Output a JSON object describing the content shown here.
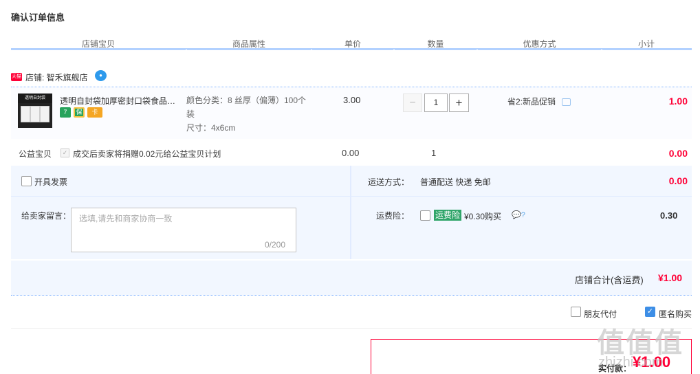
{
  "page": {
    "title": "确认订单信息"
  },
  "columns": [
    "店铺宝贝",
    "商品属性",
    "单价",
    "数量",
    "优惠方式",
    "小计"
  ],
  "shop": {
    "badge": "天猫",
    "name": "店铺: 智禾旗舰店"
  },
  "item": {
    "thumb_text": "透明自封袋",
    "title": "透明自封袋加厚密封口袋食品保鲜袋",
    "service_icons": [
      "7",
      "保",
      "卡"
    ],
    "attr_color": "颜色分类：8 丝厚（偏薄）100个",
    "attr_color_cont": "装",
    "attr_size": "尺寸：4x6cm",
    "price": "3.00",
    "quantity": "1",
    "qty_minus": "−",
    "qty_plus": "+",
    "promotion": "省2:新品促销",
    "subtotal": "1.00"
  },
  "charity": {
    "label": "公益宝贝",
    "check": "✓",
    "text": "成交后卖家将捐赠0.02元给公益宝贝计划",
    "price": "0.00",
    "quantity": "1",
    "subtotal": "0.00"
  },
  "invoice": {
    "label": "开具发票"
  },
  "shipping": {
    "label": "运送方式：",
    "value": "普通配送 快递 免邮",
    "amount": "0.00"
  },
  "message": {
    "label": "给卖家留言：",
    "placeholder": "选填,请先和商家协商一致",
    "counter": "0/200"
  },
  "insurance": {
    "label": "运费险：",
    "badge": "运费险",
    "price": "¥0.30购买",
    "help": "💬?",
    "amount": "0.30"
  },
  "shop_total": {
    "label": "店铺合计(含运费)",
    "value": "¥1.00"
  },
  "options": {
    "friend_pay": "朋友代付",
    "anonymous": "匿名购买",
    "anon_check": "✓"
  },
  "payment": {
    "label": "实付款：",
    "value": "¥1.00"
  },
  "watermark": {
    "text": "值值值",
    "url": "zhizhi.com"
  },
  "colors": {
    "accent": "#ff0036",
    "header_line": "#b2d1ff",
    "panel": "#f2f7ff",
    "insurance": "#30a56a"
  }
}
